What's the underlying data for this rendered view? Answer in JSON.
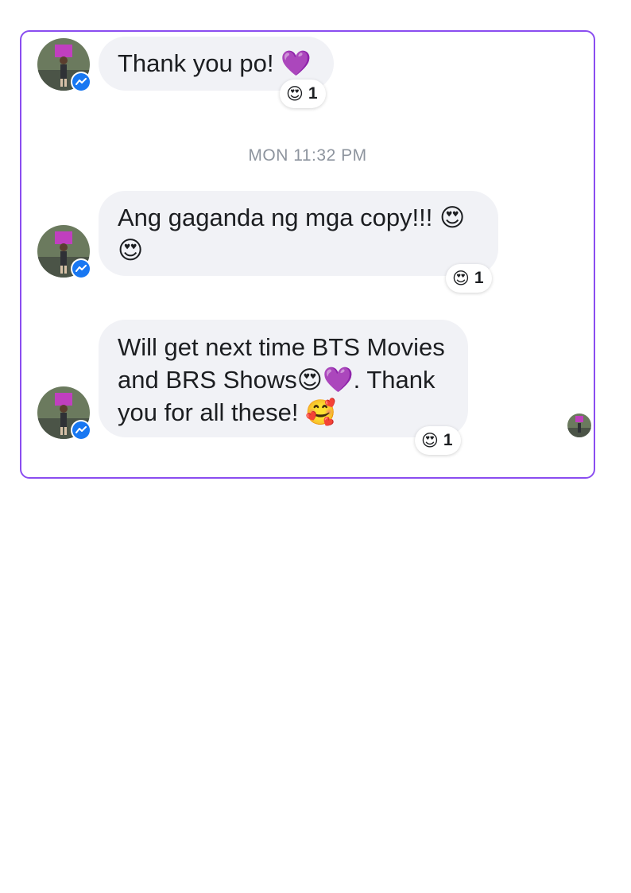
{
  "conversation": {
    "timestamp": "MON 11:32 PM",
    "messages": [
      {
        "text": "Thank you po! 💜",
        "reaction": {
          "emoji": "😍",
          "count": "1"
        }
      },
      {
        "text": "Ang gaganda ng mga copy!!! 😍\n😍",
        "reaction": {
          "emoji": "😍",
          "count": "1"
        }
      },
      {
        "text": "Will get next time BTS Movies\nand BRS Shows😍💜. Thank\nyou for all these! 🥰",
        "reaction": {
          "emoji": "😍",
          "count": "1"
        }
      }
    ]
  },
  "colors": {
    "frame_border": "#8a4df0",
    "bubble_bg": "#f1f2f6",
    "messenger_badge": "#1877f2",
    "timestamp_text": "#8d949e"
  },
  "icons": {
    "badge": "messenger-icon",
    "reaction": "heart-eyes-emoji"
  }
}
